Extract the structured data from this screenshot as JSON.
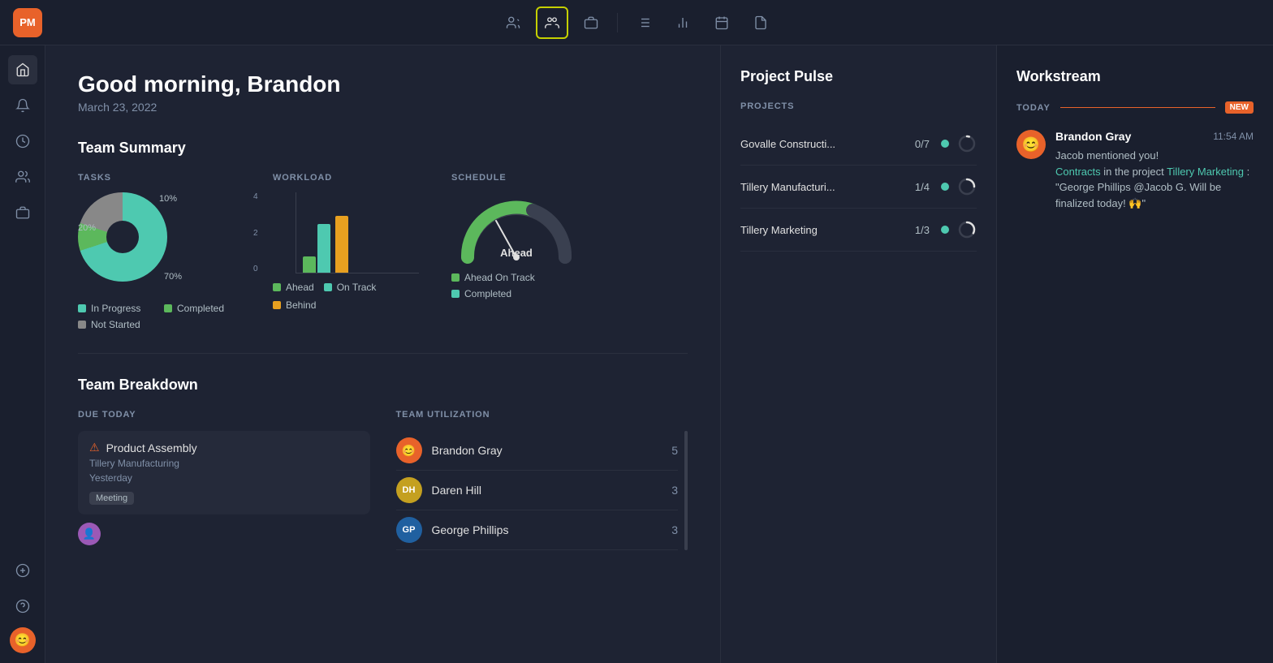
{
  "app": {
    "logo": "PM",
    "greeting": "Good morning, Brandon",
    "date": "March 23, 2022"
  },
  "topnav": {
    "icons": [
      "people-icon",
      "team-icon",
      "briefcase-icon",
      "list-icon",
      "chart-icon",
      "calendar-icon",
      "file-icon"
    ],
    "active_index": 1
  },
  "sidebar": {
    "icons": [
      "home-icon",
      "bell-icon",
      "clock-icon",
      "people-icon",
      "briefcase-icon"
    ],
    "bottom_icons": [
      "plus-icon",
      "help-icon"
    ],
    "avatar_emoji": "😊"
  },
  "team_summary": {
    "title": "Team Summary",
    "tasks": {
      "label": "TASKS",
      "segments": [
        {
          "label": "In Progress",
          "color": "#4ec9b0",
          "pct": 70
        },
        {
          "label": "Completed",
          "color": "#5cb85c",
          "pct": 10
        },
        {
          "label": "Not Started",
          "color": "#888888",
          "pct": 20
        }
      ],
      "labels": {
        "pct70": "70%",
        "pct20": "20%",
        "pct10": "10%"
      }
    },
    "workload": {
      "label": "WORKLOAD",
      "y_labels": [
        "4",
        "2",
        "0"
      ],
      "bars": [
        {
          "ahead": 20,
          "on_track": 60,
          "behind": 0
        },
        {
          "ahead": 0,
          "on_track": 0,
          "behind": 70
        }
      ],
      "legend": [
        {
          "label": "Ahead",
          "color": "#5cb85c"
        },
        {
          "label": "On Track",
          "color": "#4ec9b0"
        },
        {
          "label": "Behind",
          "color": "#e8a020"
        }
      ]
    },
    "schedule": {
      "label": "SCHEDULE",
      "status": "Ahead",
      "legend": [
        {
          "label": "Ahead On Track",
          "colors": [
            "#5cb85c",
            "#e8a020"
          ]
        },
        {
          "label": "Completed",
          "color": "#4ec9b0"
        }
      ]
    }
  },
  "team_breakdown": {
    "title": "Team Breakdown",
    "due_today": {
      "label": "DUE TODAY",
      "items": [
        {
          "name": "Product Assembly",
          "project": "Tillery Manufacturing",
          "date": "Yesterday",
          "tag": "Meeting",
          "warning": true
        }
      ]
    },
    "team_utilization": {
      "label": "TEAM UTILIZATION",
      "members": [
        {
          "name": "Brandon Gray",
          "count": 5,
          "avatar_emoji": "😊",
          "bg": "#e8622a"
        },
        {
          "name": "Daren Hill",
          "count": 3,
          "initials": "DH",
          "bg": "#c4a020"
        },
        {
          "name": "George Phillips",
          "count": 3,
          "initials": "GP",
          "bg": "#2060a0"
        }
      ]
    }
  },
  "project_pulse": {
    "title": "Project Pulse",
    "label": "PROJECTS",
    "projects": [
      {
        "name": "Govalle Constructi...",
        "progress": "0/7",
        "status_color": "#4ec9b0",
        "ring_pct": 5
      },
      {
        "name": "Tillery Manufacturi...",
        "progress": "1/4",
        "status_color": "#4ec9b0",
        "ring_pct": 25
      },
      {
        "name": "Tillery Marketing",
        "progress": "1/3",
        "status_color": "#4ec9b0",
        "ring_pct": 33
      }
    ]
  },
  "workstream": {
    "title": "Workstream",
    "today_label": "TODAY",
    "new_badge": "NEW",
    "items": [
      {
        "avatar_emoji": "😊",
        "name": "Brandon Gray",
        "time": "11:54 AM",
        "mentioned": "Jacob mentioned you!",
        "link1_text": "Contracts",
        "link1_type": "teal",
        "preposition": " in the project ",
        "link2_text": "Tillery Marketing",
        "link2_type": "teal",
        "message": ": \"George Phillips @Jacob G. Will be finalized today! 🙌\""
      }
    ]
  }
}
